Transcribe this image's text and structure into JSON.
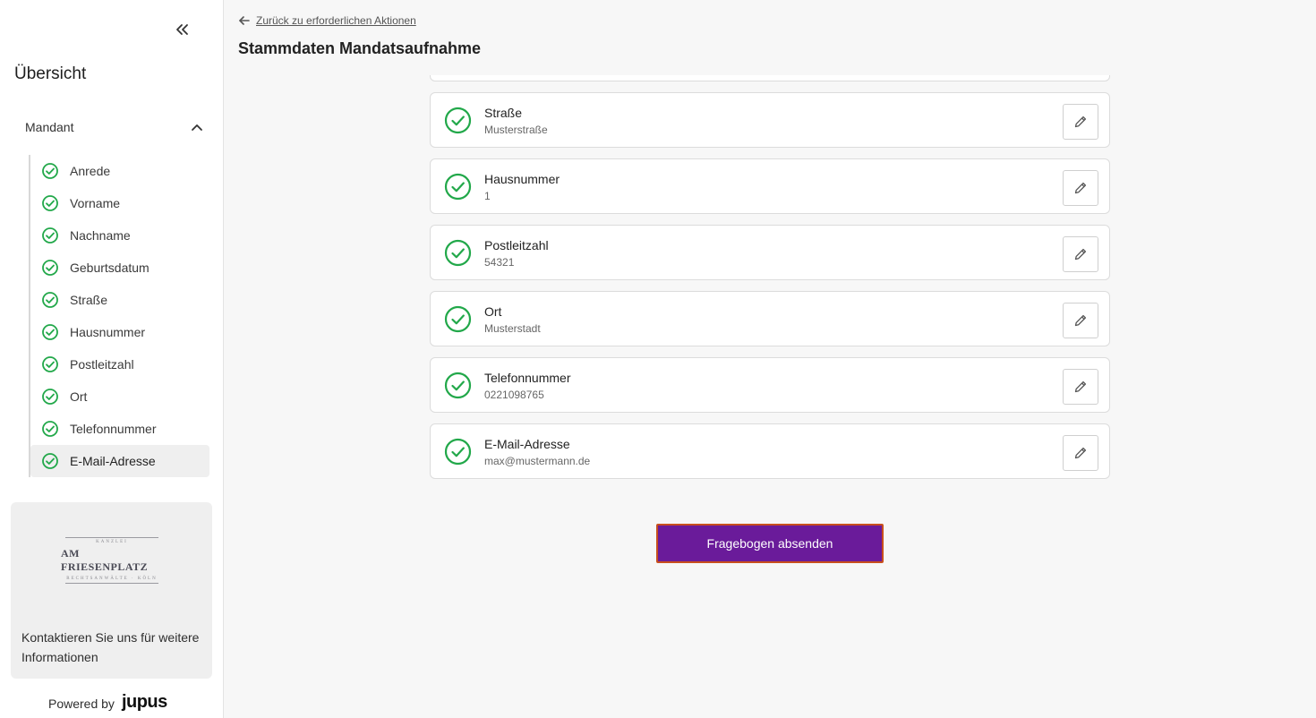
{
  "sidebar": {
    "overview_title": "Übersicht",
    "section_label": "Mandant",
    "items": [
      {
        "label": "Anrede"
      },
      {
        "label": "Vorname"
      },
      {
        "label": "Nachname"
      },
      {
        "label": "Geburtsdatum"
      },
      {
        "label": "Straße"
      },
      {
        "label": "Hausnummer"
      },
      {
        "label": "Postleitzahl"
      },
      {
        "label": "Ort"
      },
      {
        "label": "Telefonnummer"
      },
      {
        "label": "E-Mail-Adresse"
      }
    ],
    "active_item": "E-Mail-Adresse",
    "contact": {
      "logo_top": "KANZLEI",
      "logo_main": "AM FRIESENPLATZ",
      "logo_bottom": "RECHTSANWÄLTE · KÖLN",
      "text": "Kontaktieren Sie uns für weitere Informationen"
    },
    "powered_by_label": "Powered by",
    "powered_by_brand": "jupus"
  },
  "main": {
    "back_link": "Zurück zu erforderlichen Aktionen",
    "title": "Stammdaten Mandatsaufnahme",
    "fields": [
      {
        "label": "Straße",
        "value": "Musterstraße"
      },
      {
        "label": "Hausnummer",
        "value": "1"
      },
      {
        "label": "Postleitzahl",
        "value": "54321"
      },
      {
        "label": "Ort",
        "value": "Musterstadt"
      },
      {
        "label": "Telefonnummer",
        "value": "0221098765"
      },
      {
        "label": "E-Mail-Adresse",
        "value": "max@mustermann.de"
      }
    ],
    "submit_label": "Fragebogen absenden"
  },
  "colors": {
    "check_green": "#22a84a",
    "submit_bg": "#6a1b9a",
    "submit_border": "#c84f1e"
  }
}
